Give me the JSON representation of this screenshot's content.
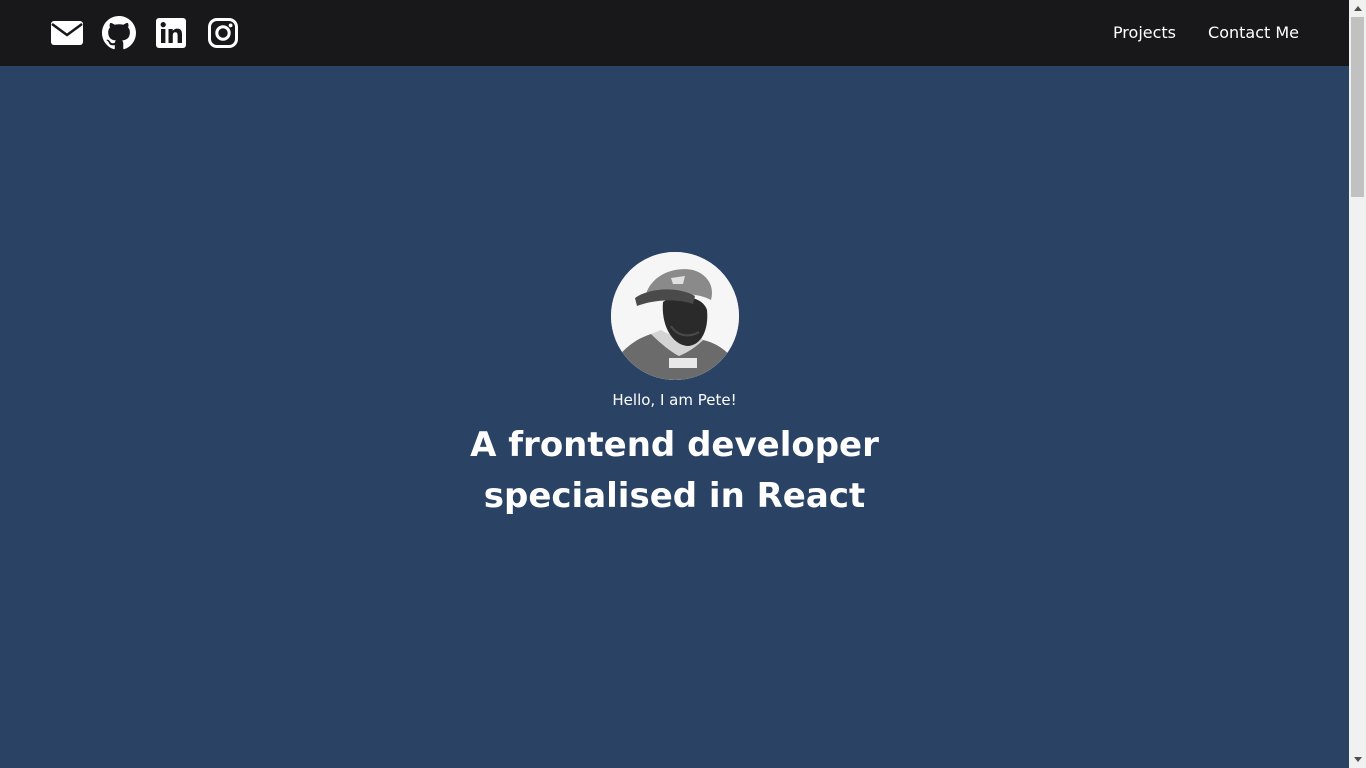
{
  "header": {
    "social_icons": [
      "envelope-icon",
      "github-icon",
      "linkedin-icon",
      "instagram-icon"
    ],
    "nav": {
      "projects_label": "Projects",
      "contact_label": "Contact Me"
    }
  },
  "hero": {
    "greeting": "Hello, I am Pete!",
    "headline": "A frontend developer specialised in React"
  },
  "colors": {
    "header_bg": "#18181b",
    "page_bg": "#2a4365",
    "text": "#ffffff"
  }
}
